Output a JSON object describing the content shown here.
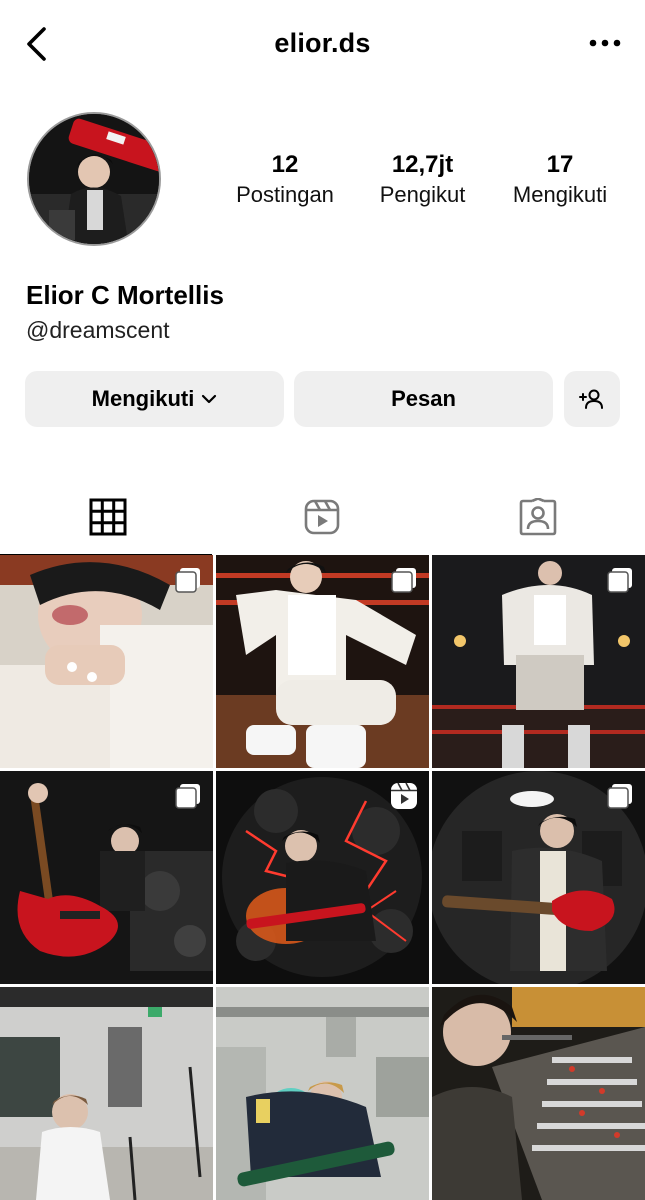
{
  "header": {
    "username": "elior.ds",
    "back_icon": "chevron-left-icon",
    "more_icon": "more-horizontal-icon"
  },
  "profile": {
    "full_name": "Elior C Mortellis",
    "handle": "@dreamscent",
    "stats": [
      {
        "value": "12",
        "label": "Postingan"
      },
      {
        "value": "12,7jt",
        "label": "Pengikut"
      },
      {
        "value": "17",
        "label": "Mengikuti"
      }
    ]
  },
  "actions": {
    "follow_label": "Mengikuti",
    "message_label": "Pesan",
    "add_user_icon": "add-user-icon"
  },
  "tabs": [
    {
      "icon": "grid-icon",
      "active": true
    },
    {
      "icon": "reels-icon",
      "active": false
    },
    {
      "icon": "tagged-icon",
      "active": false
    }
  ],
  "posts": [
    {
      "type": "carousel"
    },
    {
      "type": "carousel"
    },
    {
      "type": "carousel"
    },
    {
      "type": "carousel"
    },
    {
      "type": "reel"
    },
    {
      "type": "carousel"
    },
    {
      "type": "photo"
    },
    {
      "type": "photo"
    },
    {
      "type": "photo"
    }
  ],
  "colors": {
    "button_bg": "#efefef",
    "text": "#000000",
    "accent_red": "#c8141e"
  }
}
